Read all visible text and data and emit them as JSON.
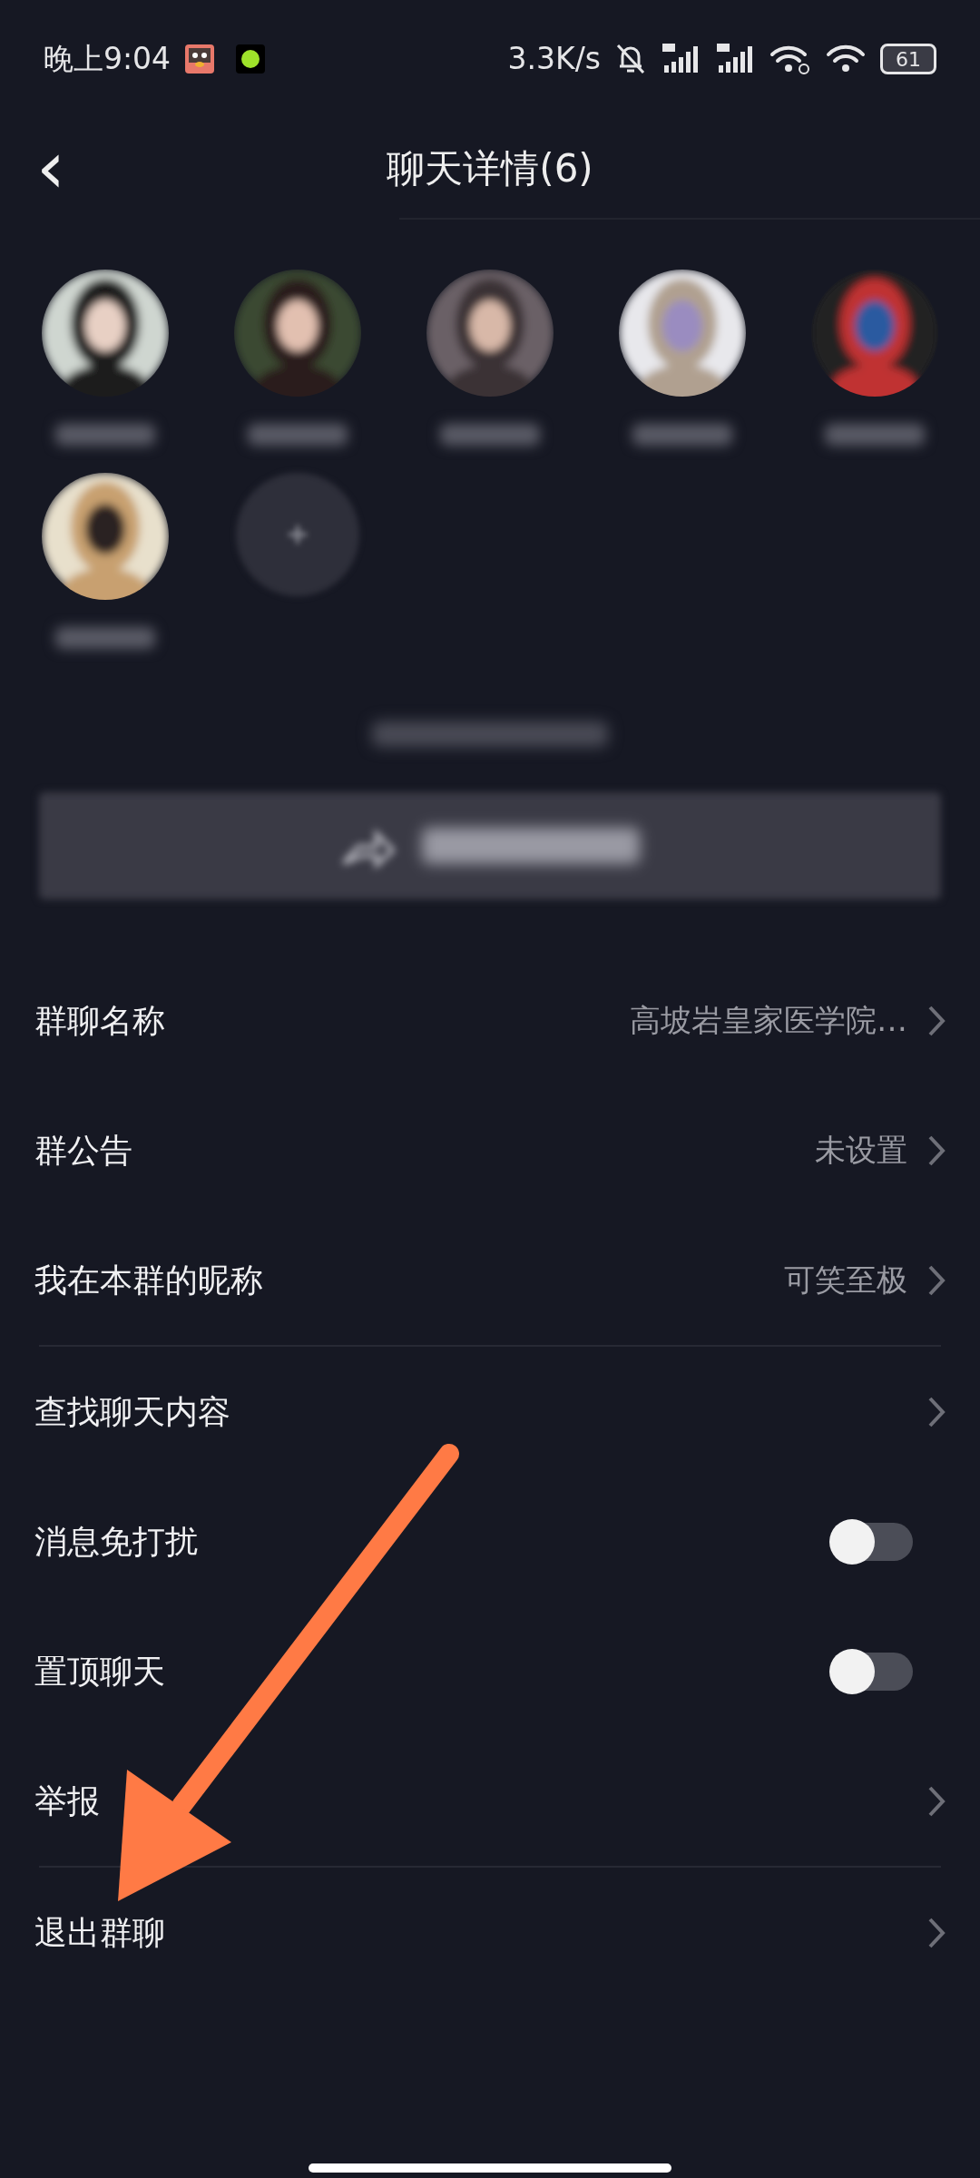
{
  "status_bar": {
    "time": "晚上9:04",
    "speed": "3.3K/s",
    "battery": "61"
  },
  "header": {
    "back": "‹",
    "title": "聊天详情(6)"
  },
  "members": [
    {
      "kind": "picture"
    },
    {
      "kind": "picture"
    },
    {
      "kind": "picture"
    },
    {
      "kind": "picture"
    },
    {
      "kind": "picture"
    },
    {
      "kind": "picture"
    },
    {
      "kind": "add"
    }
  ],
  "groups": [
    [
      {
        "kind": "link",
        "label": "群聊名称",
        "value": "高坡岩皇家医学院…"
      },
      {
        "kind": "link",
        "label": "群公告",
        "value": "未设置"
      },
      {
        "kind": "link",
        "label": "我在本群的昵称",
        "value": "可笑至极"
      }
    ],
    [
      {
        "kind": "link",
        "label": "查找聊天内容"
      },
      {
        "kind": "toggle",
        "label": "消息免打扰",
        "on": false
      },
      {
        "kind": "toggle",
        "label": "置顶聊天",
        "on": false
      },
      {
        "kind": "link",
        "label": "举报"
      }
    ],
    [
      {
        "kind": "link",
        "label": "退出群聊"
      }
    ]
  ],
  "annotation": {
    "kind": "arrow"
  }
}
